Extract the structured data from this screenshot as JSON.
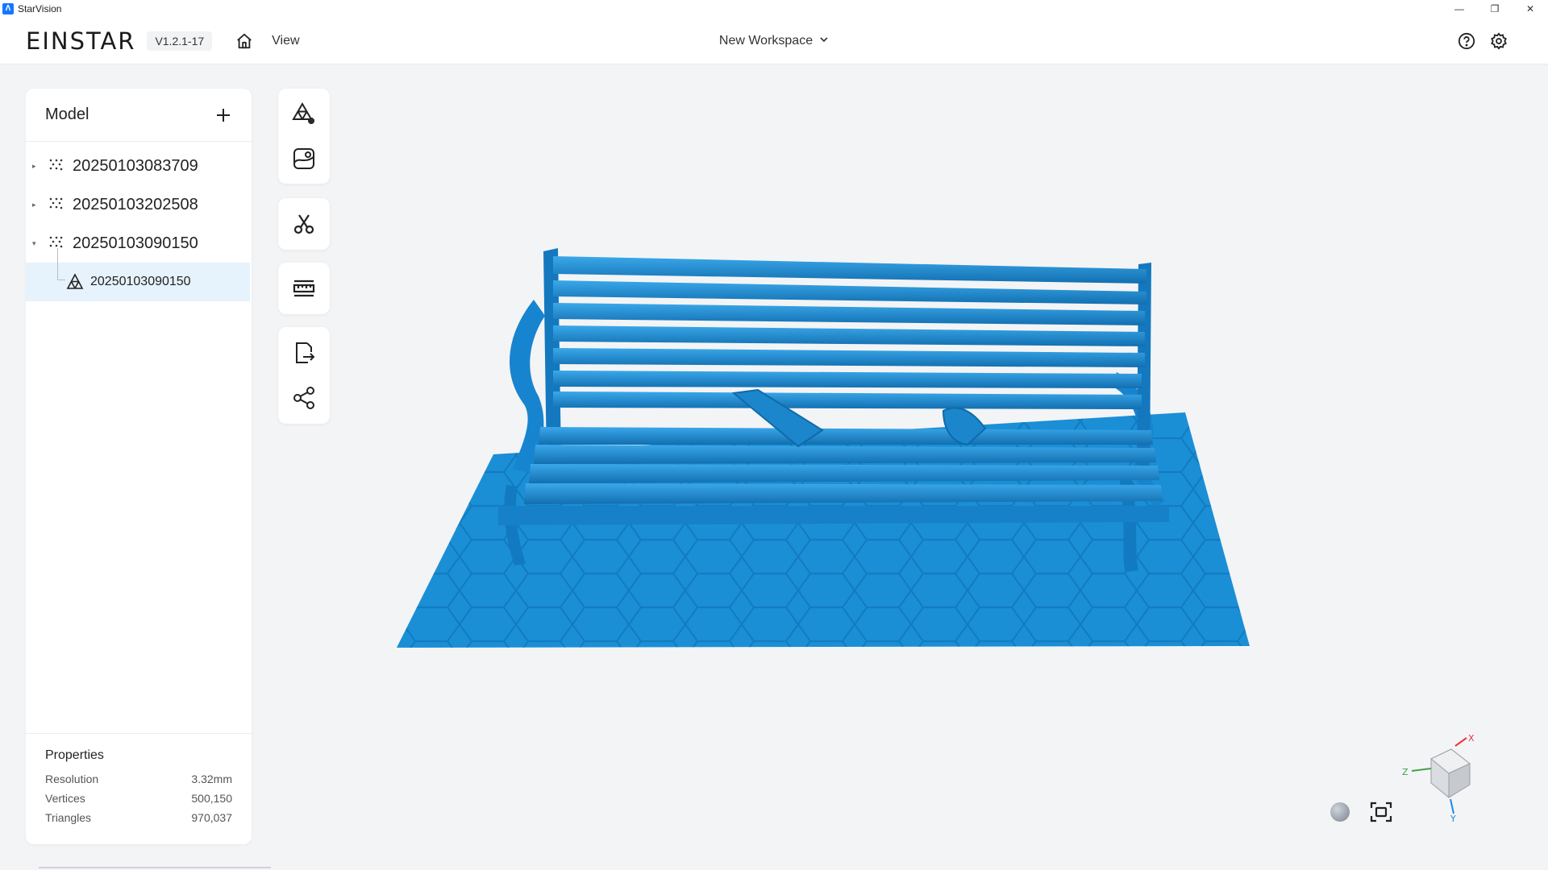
{
  "window": {
    "app_title": "StarVision",
    "app_icon_glyph": "Λ",
    "controls": {
      "minimize": "—",
      "restore": "❐",
      "close": "✕"
    }
  },
  "header": {
    "logo": "EINSTAR",
    "version": "V1.2.1-17",
    "view_menu": "View",
    "workspace": "New Workspace",
    "icons": [
      "home-icon",
      "help-icon",
      "settings-icon",
      "chevron-down-icon"
    ]
  },
  "model_panel": {
    "title": "Model",
    "items": [
      {
        "label": "20250103083709",
        "expanded": false,
        "caret": "▸"
      },
      {
        "label": "20250103202508",
        "expanded": false,
        "caret": "▸"
      },
      {
        "label": "20250103090150",
        "expanded": true,
        "caret": "▾"
      }
    ],
    "child": {
      "label": "20250103090150",
      "selected": true
    }
  },
  "properties": {
    "title": "Properties",
    "rows": [
      {
        "label": "Resolution",
        "value": "3.32mm"
      },
      {
        "label": "Vertices",
        "value": "500,150"
      },
      {
        "label": "Triangles",
        "value": "970,037"
      }
    ]
  },
  "toolbar": {
    "groups": [
      [
        "mesh-settings-icon",
        "texture-icon"
      ],
      [
        "cut-icon"
      ],
      [
        "measure-icon"
      ],
      [
        "export-icon",
        "share-icon"
      ]
    ]
  },
  "viewport": {
    "model_color": "#1a8fd6",
    "axes": {
      "x": "X",
      "y": "Y",
      "z": "Z"
    },
    "axis_colors": {
      "x": "#e53935",
      "y": "#1e88e5",
      "z": "#43a047"
    }
  },
  "colors": {
    "accent": "#1677ff",
    "selection": "#e6f2fc",
    "background": "#f3f4f6"
  }
}
